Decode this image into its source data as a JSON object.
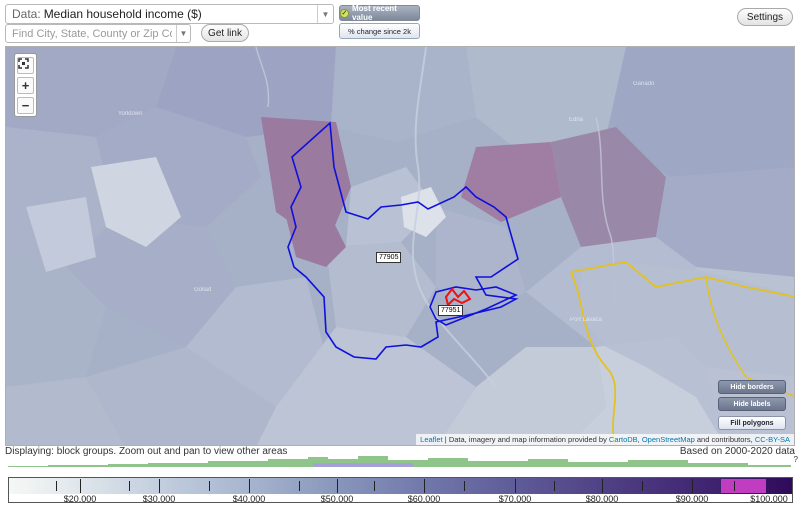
{
  "controls": {
    "data_prefix": "Data:",
    "data_value": "Median household income ($)",
    "search_placeholder": "Find City, State, County or Zip Code",
    "get_link_label": "Get link",
    "most_recent_label": "Most recent value",
    "change_since_label": "% change since 2k",
    "settings_label": "Settings"
  },
  "map": {
    "tract_labels": [
      "77905",
      "77951"
    ],
    "place_labels": [
      "Yorktown",
      "Goliad",
      "Edna",
      "Port Lavaca",
      "Ganado"
    ],
    "buttons": [
      "Hide borders",
      "Hide labels",
      "Fill polygons"
    ],
    "attribution": {
      "leaflet": "Leaflet",
      "text_1": " | Data, imagery and map information provided by ",
      "cartodb": "CartoDB",
      "text_2": ", ",
      "osm": "OpenStreetMap",
      "text_3": " and contributors, ",
      "license": "CC-BY-SA"
    },
    "colors": {
      "highlight_border": "#1010dd",
      "selected_border": "#ee1111",
      "county_line": "#e3c21f"
    }
  },
  "status": {
    "displaying": "Displaying: block groups. Zoom out and pan to view other areas",
    "based_on": "Based on 2000-2020 data",
    "question_mark": "?"
  },
  "legend": {
    "labels": [
      "$20,000",
      "$30,000",
      "$40,000",
      "$50,000",
      "$60,000",
      "$70,000",
      "$80,000",
      "$90,000",
      "$100,000"
    ],
    "highlight_color": "#c03cc0"
  }
}
